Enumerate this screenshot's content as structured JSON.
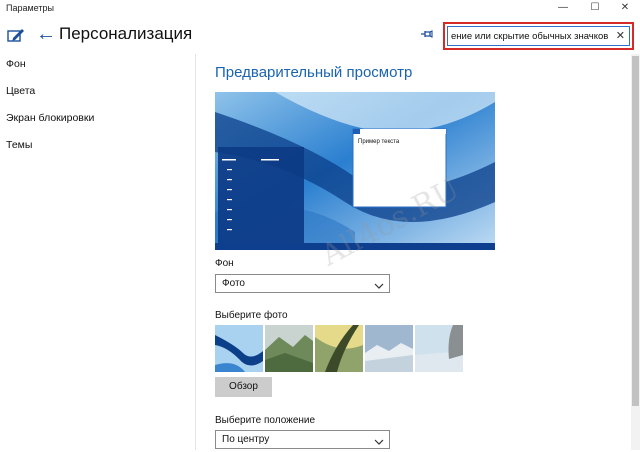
{
  "window": {
    "title": "Параметры",
    "minimize_glyph": "—",
    "maximize_glyph": "☐",
    "close_glyph": "✕"
  },
  "header": {
    "back_glyph": "←",
    "page_title": "Персонализация",
    "search": {
      "value": "ение или скрытие обычных значков",
      "clear_glyph": "✕"
    }
  },
  "sidebar": {
    "items": [
      {
        "label": "Фон"
      },
      {
        "label": "Цвета"
      },
      {
        "label": "Экран блокировки"
      },
      {
        "label": "Темы"
      }
    ]
  },
  "main": {
    "preview_title": "Предварительный просмотр",
    "preview_sample_text": "Пример текста",
    "background_label": "Фон",
    "background_value": "Фото",
    "choose_photo_label": "Выберите фото",
    "browse_label": "Обзор",
    "choose_position_label": "Выберите положение",
    "position_value": "По центру"
  },
  "watermark": "All4os.RU",
  "icons": {
    "edit": "pen-window-icon",
    "back": "back-arrow-icon",
    "pin": "pin-icon",
    "clear": "close-icon",
    "chevron": "chevron-down-icon"
  },
  "colors": {
    "accent": "#1a64b0",
    "highlight_border": "#d42a2a",
    "search_border": "#2f6fce",
    "taskbar": "#0e3f8f"
  }
}
